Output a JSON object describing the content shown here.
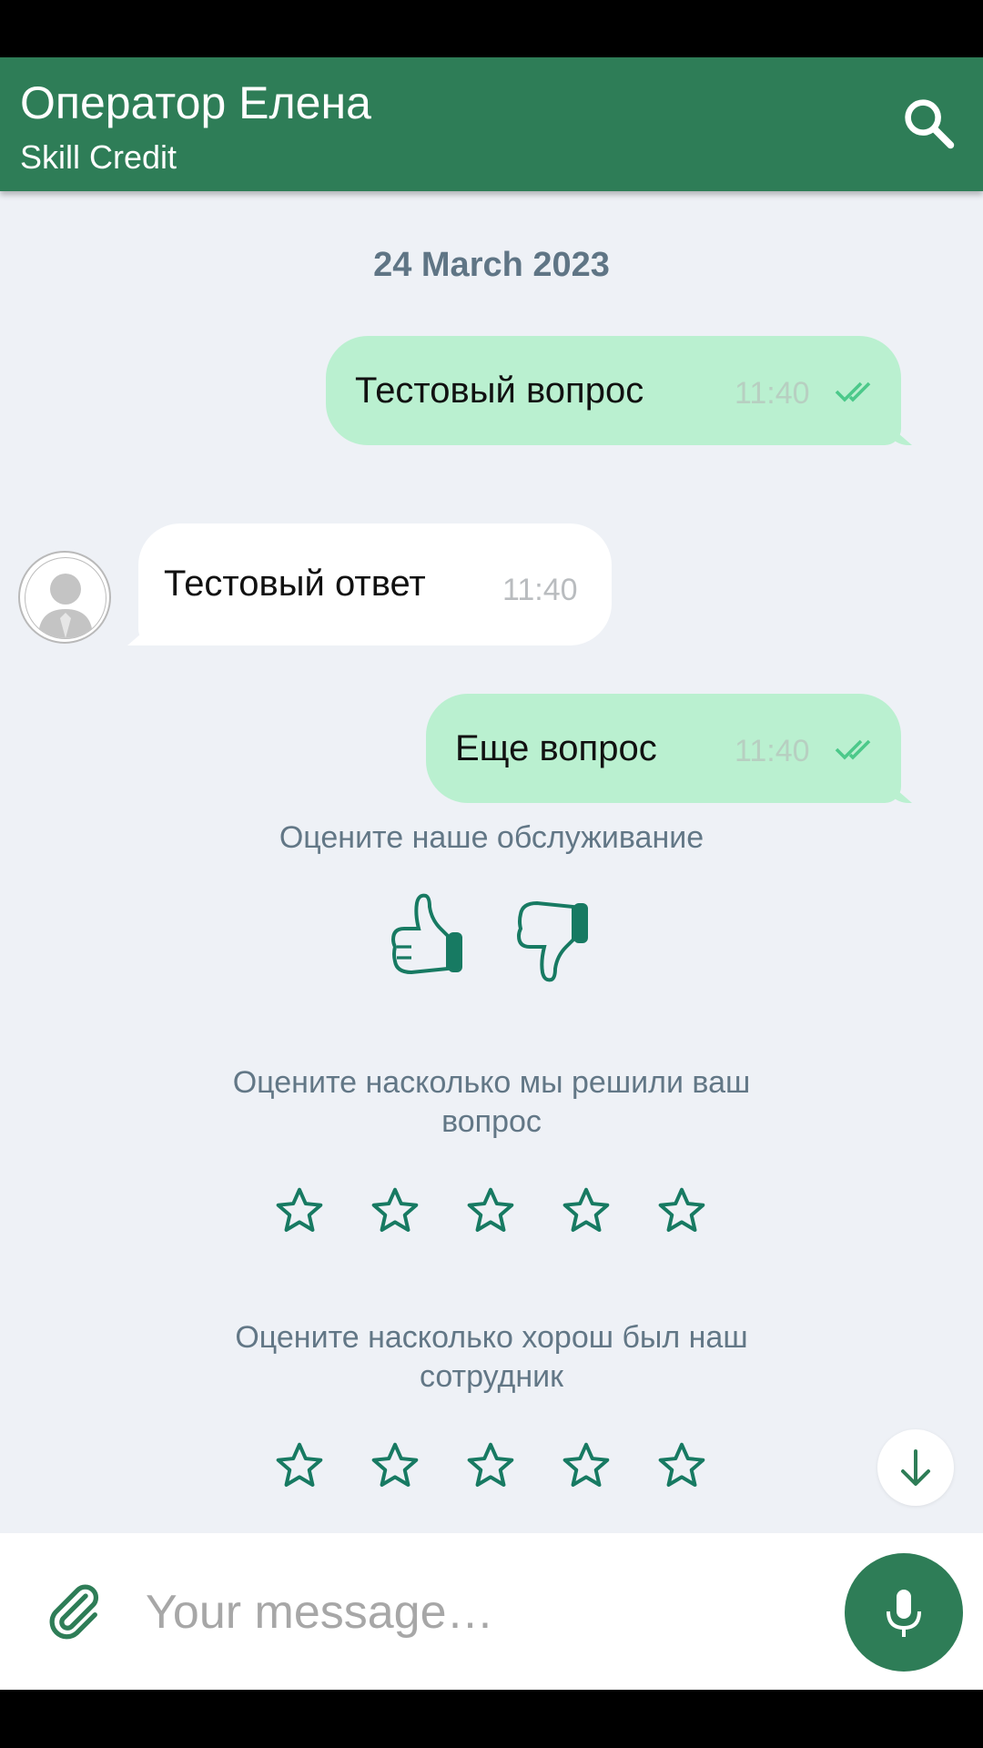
{
  "header": {
    "title": "Оператор Елена",
    "subtitle": "Skill Credit",
    "search_icon": "search-icon"
  },
  "chat": {
    "date_separator": "24 March 2023",
    "messages": [
      {
        "direction": "outgoing",
        "text": "Тестовый вопрос",
        "time": "11:40",
        "status": "read"
      },
      {
        "direction": "incoming",
        "text": "Тестовый ответ",
        "time": "11:40"
      },
      {
        "direction": "outgoing",
        "text": "Еще вопрос",
        "time": "11:40",
        "status": "read"
      }
    ]
  },
  "rating": {
    "service_prompt": "Оцените наше обслуживание",
    "resolution_prompt_line1": "Оцените насколько мы решили ваш",
    "resolution_prompt_line2": "вопрос",
    "employee_prompt_line1": "Оцените насколько хорош был наш",
    "employee_prompt_line2": "сотрудник",
    "stars_count": 5,
    "resolution_stars_selected": 0,
    "employee_stars_selected": 0
  },
  "composer": {
    "placeholder": "Your message…",
    "attach_icon": "paperclip-icon",
    "mic_icon": "microphone-icon"
  },
  "colors": {
    "accent": "#2e7d57",
    "outgoing_bubble": "#baf0d0",
    "incoming_bubble": "#ffffff",
    "chat_background": "#eef1f6",
    "rating_icon": "#177a62"
  }
}
